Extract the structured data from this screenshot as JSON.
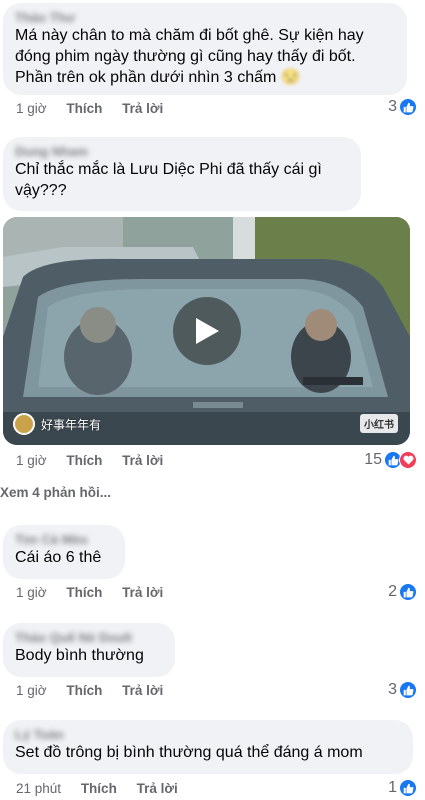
{
  "comments": [
    {
      "author": "Thảo Thư",
      "text": "Má này chân to mà chăm đi bốt ghê. Sự kiện hay đóng phim ngày thường gì cũng hay thấy đi bốt. Phần trên ok phần dưới nhìn 3 chấm",
      "emoji": "😒",
      "time": "1 giờ",
      "like_label": "Thích",
      "reply_label": "Trả lời",
      "reaction_count": "3",
      "reactions": [
        "like"
      ]
    },
    {
      "author": "Dung Nham",
      "text": "Chỉ thắc mắc là Lưu Diệc Phi đã thấy cái gì vậy???",
      "time": "1 giờ",
      "like_label": "Thích",
      "reply_label": "Trả lời",
      "reaction_count": "15",
      "reactions": [
        "like",
        "love"
      ],
      "video": {
        "watermark_left": "好事年年有",
        "watermark_right": "小红书"
      }
    },
    {
      "author": "Tim Cá Mèo",
      "text": "Cái áo 6 thê",
      "time": "1 giờ",
      "like_label": "Thích",
      "reply_label": "Trả lời",
      "reaction_count": "2",
      "reactions": [
        "like"
      ]
    },
    {
      "author": "Thảo Quế Nè Doult",
      "text": "Body bình thường",
      "time": "1 giờ",
      "like_label": "Thích",
      "reply_label": "Trả lời",
      "reaction_count": "3",
      "reactions": [
        "like"
      ]
    },
    {
      "author": "Lý Toàn",
      "text": "Set đồ trông bị bình thường quá thể đáng á mom",
      "time": "21 phút",
      "like_label": "Thích",
      "reply_label": "Trả lời",
      "reaction_count": "1",
      "reactions": [
        "like"
      ]
    }
  ],
  "view_replies": "Xem 4 phản hồi...",
  "colors": {
    "bubble_bg": "#f0f2f5",
    "like_blue": "#1877f2",
    "love_red": "#f33e58",
    "meta_gray": "#65676b"
  }
}
